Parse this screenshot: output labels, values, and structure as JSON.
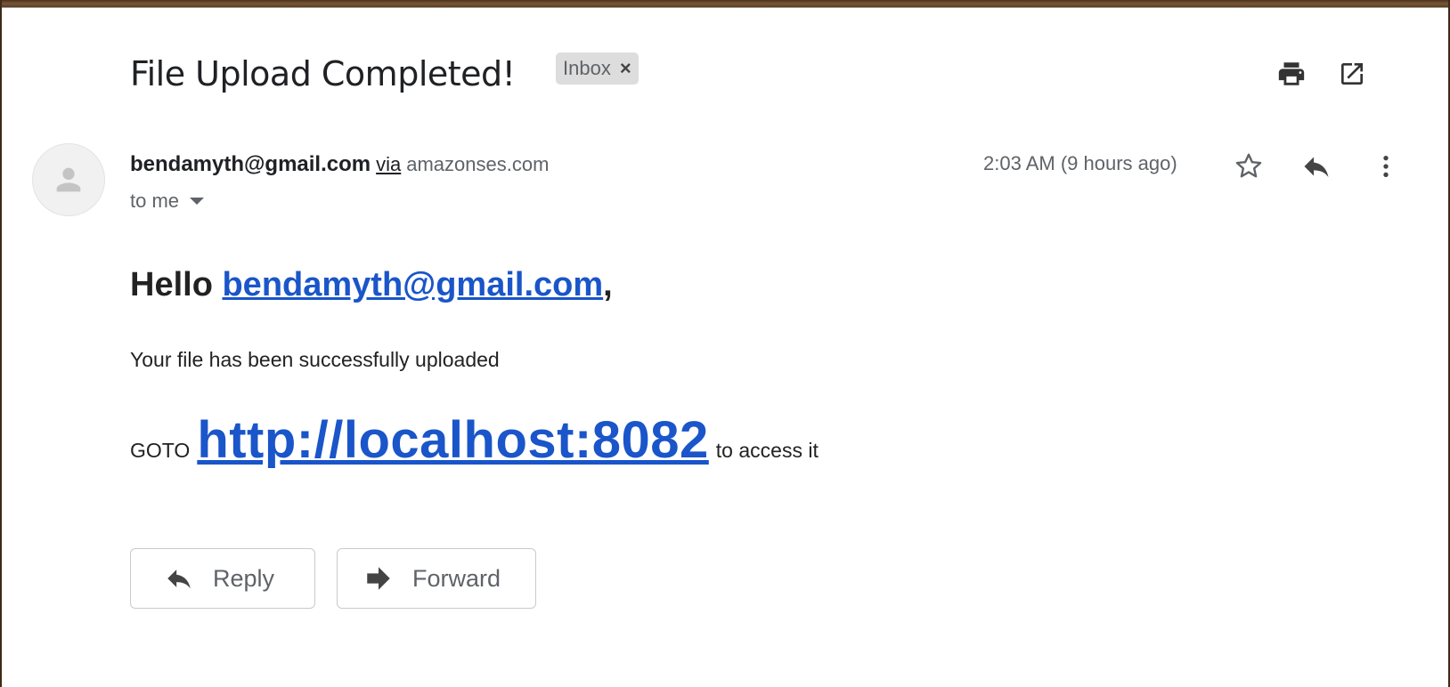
{
  "email": {
    "subject": "File Upload Completed!",
    "label": "Inbox",
    "label_remove": "×",
    "sender": {
      "address": "bendamyth@gmail.com",
      "via_text": "via",
      "via_domain": "amazonses.com"
    },
    "recipient_text": "to me",
    "time": "2:03 AM (9 hours ago)",
    "body": {
      "greeting_prefix": "Hello ",
      "greeting_link": "bendamyth@gmail.com",
      "greeting_suffix": ",",
      "message": "Your file has been successfully uploaded",
      "goto_prefix": "GOTO",
      "goto_link": "http://localhost:8082",
      "goto_suffix": "to access it"
    }
  },
  "actions": {
    "reply_label": "Reply",
    "forward_label": "Forward"
  },
  "icons": {
    "print": "print-icon",
    "open_new_window": "open-in-new-window-icon",
    "star": "star-icon",
    "reply": "reply-icon",
    "more": "more-vertical-icon",
    "forward": "forward-icon",
    "avatar": "person-icon"
  },
  "colors": {
    "link": "#1a55c9",
    "icon": "#5f6368",
    "label_chip_bg": "#dddddd"
  }
}
